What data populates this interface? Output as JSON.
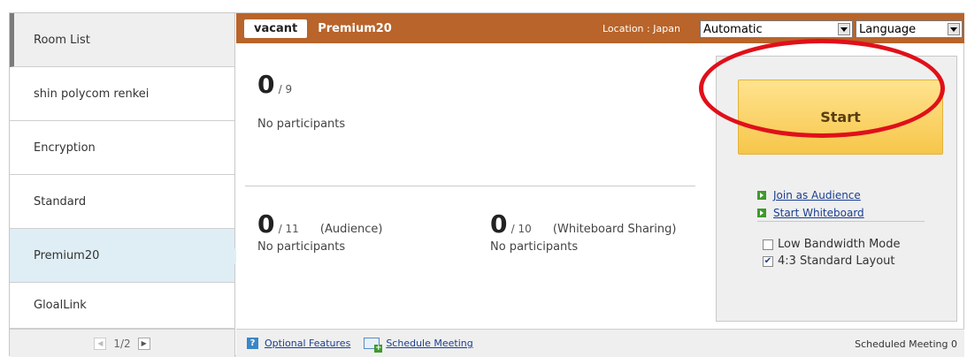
{
  "sidebar": {
    "header": "Room List",
    "rooms": [
      "shin polycom renkei",
      "Encryption",
      "Standard",
      "Premium20",
      "GloalLink"
    ],
    "active_room": "Premium20",
    "pager": {
      "page": "1/2",
      "prev_icon": "chevron-left-icon",
      "next_icon": "chevron-right-icon"
    }
  },
  "topbar": {
    "status": "vacant",
    "room_name": "Premium20",
    "location_label": "Location",
    "location_value": ": Japan",
    "timezone_select": "Automatic",
    "language_select": "Language",
    "bar_color": "#b8642a"
  },
  "main": {
    "participants": {
      "count": "0",
      "max": "/ 9",
      "text": "No participants"
    },
    "audience": {
      "count": "0",
      "max": "/ 11",
      "label": "(Audience)",
      "text": "No participants"
    },
    "whiteboard": {
      "count": "0",
      "max": "/ 10",
      "label": "(Whiteboard Sharing)",
      "text": "No participants"
    }
  },
  "panel": {
    "start_label": "Start",
    "join_audience": "Join as Audience",
    "start_whiteboard": "Start Whiteboard",
    "low_bandwidth": {
      "label": "Low Bandwidth Mode",
      "checked": false
    },
    "layout_43": {
      "label": "4:3 Standard Layout",
      "checked": true
    },
    "highlight_color": "#e0101a"
  },
  "footer": {
    "optional_features": "Optional Features",
    "schedule_meeting": "Schedule Meeting",
    "scheduled_meeting": "Scheduled Meeting 0"
  }
}
